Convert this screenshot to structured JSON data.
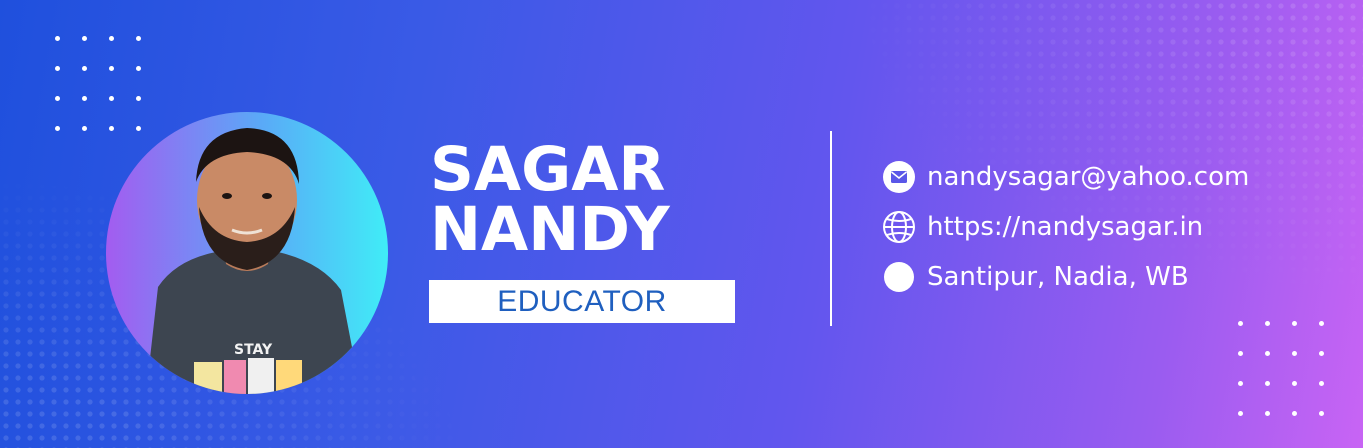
{
  "profile": {
    "first_name": "SAGAR",
    "last_name": "NANDY",
    "role": "EDUCATOR"
  },
  "contacts": {
    "email": "nandysagar@yahoo.com",
    "website": "https://nandysagar.in",
    "location": "Santipur, Nadia, WB"
  },
  "colors": {
    "gradient_start": "#1f50dd",
    "gradient_end": "#c864f4",
    "role_text": "#1f5fbf"
  },
  "icons": [
    "mail-icon",
    "globe-icon",
    "location-icon"
  ]
}
